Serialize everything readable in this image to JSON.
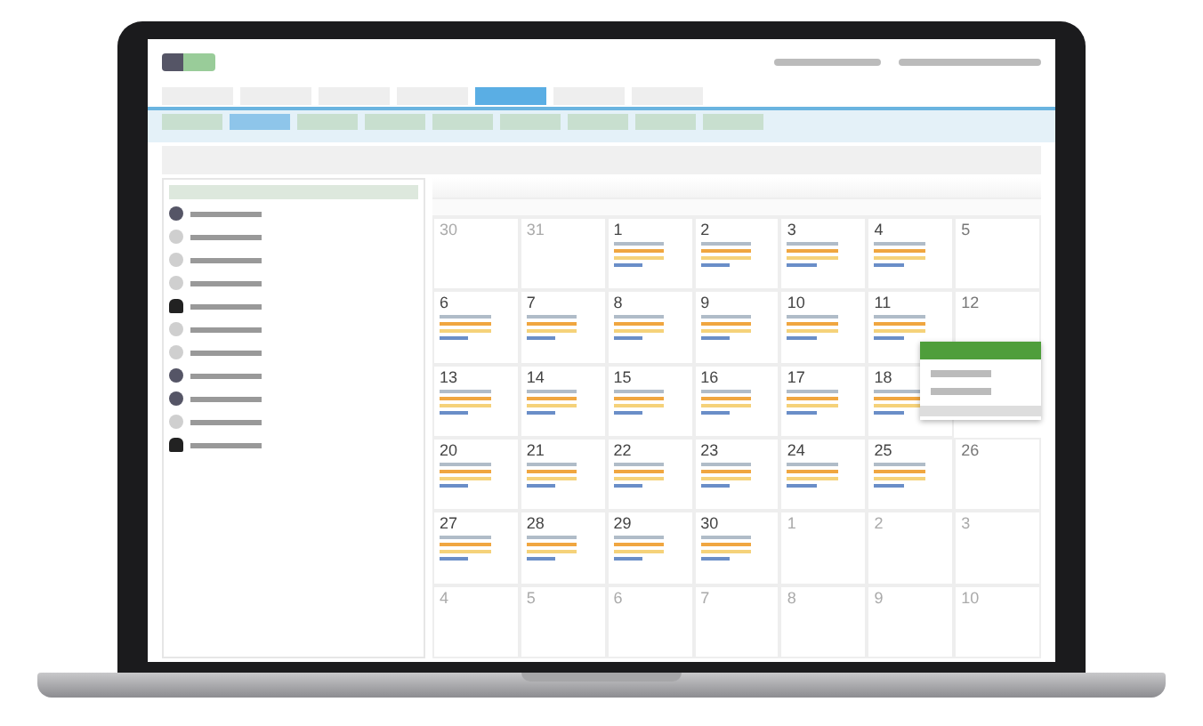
{
  "nav_tabs": [
    {
      "selected": false
    },
    {
      "selected": false
    },
    {
      "selected": false
    },
    {
      "selected": false
    },
    {
      "selected": true
    },
    {
      "selected": false
    },
    {
      "selected": false
    }
  ],
  "sub_tabs": [
    {
      "selected": false
    },
    {
      "selected": true
    },
    {
      "selected": false
    },
    {
      "selected": false
    },
    {
      "selected": false
    },
    {
      "selected": false
    },
    {
      "selected": false
    },
    {
      "selected": false
    },
    {
      "selected": false
    }
  ],
  "contacts": [
    {
      "kind": "photo"
    },
    {
      "kind": "icon"
    },
    {
      "kind": "icon"
    },
    {
      "kind": "icon"
    },
    {
      "kind": "person"
    },
    {
      "kind": "icon"
    },
    {
      "kind": "icon"
    },
    {
      "kind": "photo"
    },
    {
      "kind": "photo"
    },
    {
      "kind": "icon"
    },
    {
      "kind": "person"
    }
  ],
  "calendar": {
    "weeks": [
      [
        {
          "day": "30",
          "kind": "other"
        },
        {
          "day": "31",
          "kind": "other"
        },
        {
          "day": "1",
          "kind": "current"
        },
        {
          "day": "2",
          "kind": "current"
        },
        {
          "day": "3",
          "kind": "current"
        },
        {
          "day": "4",
          "kind": "current"
        },
        {
          "day": "5",
          "kind": "weekend"
        }
      ],
      [
        {
          "day": "6",
          "kind": "current"
        },
        {
          "day": "7",
          "kind": "current"
        },
        {
          "day": "8",
          "kind": "current"
        },
        {
          "day": "9",
          "kind": "current"
        },
        {
          "day": "10",
          "kind": "current"
        },
        {
          "day": "11",
          "kind": "current"
        },
        {
          "day": "12",
          "kind": "weekend"
        }
      ],
      [
        {
          "day": "13",
          "kind": "current"
        },
        {
          "day": "14",
          "kind": "current"
        },
        {
          "day": "15",
          "kind": "current"
        },
        {
          "day": "16",
          "kind": "current"
        },
        {
          "day": "17",
          "kind": "current"
        },
        {
          "day": "18",
          "kind": "current"
        }
      ],
      [
        {
          "day": "20",
          "kind": "current"
        },
        {
          "day": "21",
          "kind": "current"
        },
        {
          "day": "22",
          "kind": "current"
        },
        {
          "day": "23",
          "kind": "current"
        },
        {
          "day": "24",
          "kind": "current"
        },
        {
          "day": "25",
          "kind": "current"
        },
        {
          "day": "26",
          "kind": "weekend"
        }
      ],
      [
        {
          "day": "27",
          "kind": "current"
        },
        {
          "day": "28",
          "kind": "current"
        },
        {
          "day": "29",
          "kind": "current"
        },
        {
          "day": "30",
          "kind": "current"
        },
        {
          "day": "1",
          "kind": "other"
        },
        {
          "day": "2",
          "kind": "other"
        },
        {
          "day": "3",
          "kind": "other"
        }
      ],
      [
        {
          "day": "4",
          "kind": "other"
        },
        {
          "day": "5",
          "kind": "other"
        },
        {
          "day": "6",
          "kind": "other"
        },
        {
          "day": "7",
          "kind": "other"
        },
        {
          "day": "8",
          "kind": "other"
        },
        {
          "day": "9",
          "kind": "other"
        },
        {
          "day": "10",
          "kind": "other"
        }
      ]
    ]
  },
  "popup_items": [
    {
      "selected": false
    },
    {
      "selected": false
    },
    {
      "selected": true
    }
  ]
}
